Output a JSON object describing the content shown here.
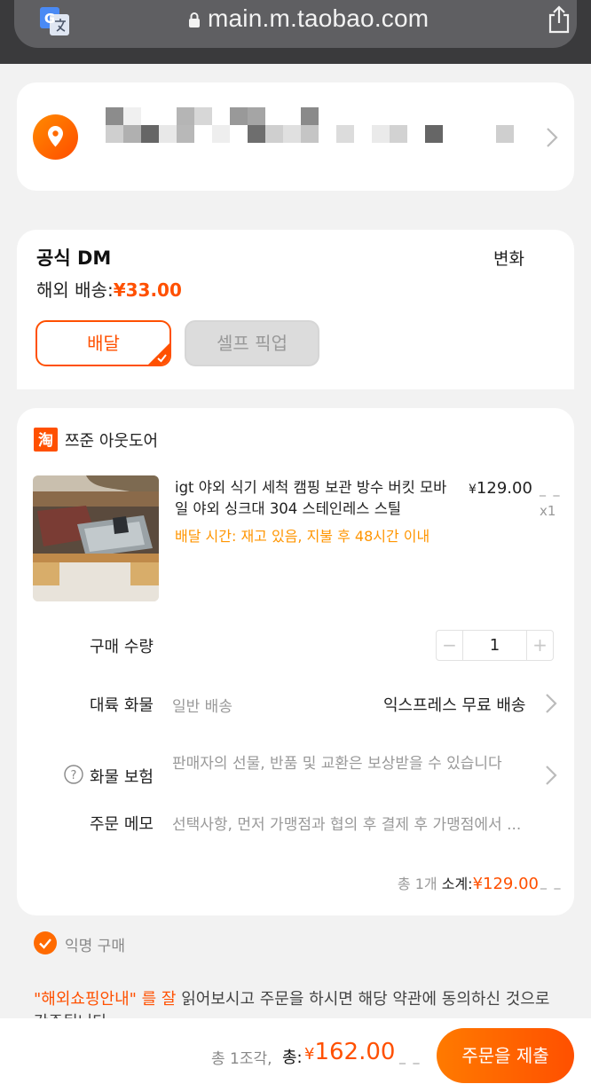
{
  "browser": {
    "url": "main.m.taobao.com",
    "translate_icon": "translate-icon",
    "share_icon": "share-icon"
  },
  "address": {
    "pin_icon": "location-pin-icon",
    "chevron_icon": "chevron-right-icon"
  },
  "shipping": {
    "title": "공식 DM",
    "change_label": "변화",
    "fee_label": "해외 배송:",
    "fee": "¥33.00",
    "deliver_label": "배달",
    "pickup_label": "셀프 픽업"
  },
  "order": {
    "shop_name": "쯔준 아웃도어",
    "shop_icon": "taobao-shop-icon",
    "product_title": "igt 야외 식기 세척 캠핑 보관 방수 버킷 모바일 야외 싱크대 304 스테인레스 스틸",
    "delivery_time": "배달 시간: 재고 있음, 지불 후 48시간 이내",
    "price_symbol": "¥",
    "price": "129.00",
    "price_suffix": "_ _",
    "quantity_label": "x1",
    "purchase_qty_label": "구매 수량",
    "stepper_minus": "−",
    "stepper_plus": "+",
    "stepper_value": "1",
    "cargo_label": "대륙 화물",
    "cargo_value": "일반 배송",
    "express_label": "익스프레스 무료 배송",
    "insurance_label": "화물 보험",
    "insurance_text": "판매자의 선물, 반품 및 교환은 보상받을 수 있습니다",
    "memo_label": "주문 메모",
    "memo_placeholder": "선택사항, 먼저 가맹점과 협의 후 결제 후 가맹점에서 ...",
    "subtotal_count": "총 1개",
    "subtotal_label": "소계:",
    "subtotal_symbol": "¥",
    "subtotal_amount": "129.00",
    "subtotal_suffix": "_ _"
  },
  "anonymous": {
    "label": "익명 구매",
    "checked": true
  },
  "notice": {
    "link_text": "\"해외쇼핑안내\" 를 잘",
    "text": " 읽어보시고 주문을 하시면 해당 약관에 동의하신 것으로 간주됩니다"
  },
  "footer": {
    "count_text": "총 1조각,",
    "total_label": "총:",
    "total_symbol": "¥",
    "total_amount": "162.00",
    "total_suffix": "_ _",
    "submit_label": "주문을 제출"
  },
  "colors": {
    "accent": "#ff5000",
    "delivery_time": "#ff9500",
    "browser_bar": "#3a3a3c"
  }
}
